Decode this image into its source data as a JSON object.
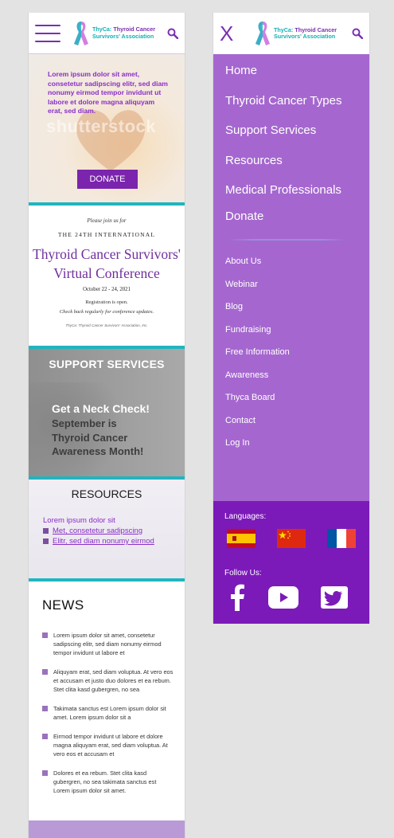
{
  "logo": {
    "line1_brand": "ThyCa:",
    "line1_rest": "Thyroid Cancer",
    "line2": "Survivors' Association"
  },
  "hero": {
    "text": "Lorem ipsum dolor sit amet, consetetur sadipscing elitr, sed diam nonumy eirmod tempor invidunt ut labore et dolore magna aliquyam erat, sed diam.",
    "watermark": "shutterstock",
    "donate_label": "DONATE"
  },
  "conference": {
    "join": "Please join us for",
    "intl": "THE 24TH INTERNATIONAL",
    "title_line1": "Thyroid Cancer Survivors'",
    "title_line2": "Virtual Conference",
    "dates": "October 22 - 24, 2021",
    "reg_open": "Registration is open.",
    "reg_check": "Check back regularly for conference updates.",
    "footer": "ThyCa: Thyroid Cancer Survivors' Association, Inc."
  },
  "support": {
    "heading": "SUPPORT SERVICES",
    "neck_check": "Get a Neck Check!",
    "awareness_line1": "September is",
    "awareness_line2": "Thyroid Cancer",
    "awareness_line3": "Awareness Month!"
  },
  "resources": {
    "heading": "RESOURCES",
    "lead": "Lorem ipsum dolor sit",
    "items": [
      "Met, consetetur sadipscing",
      "Elitr, sed diam nonumy eirmod"
    ]
  },
  "news": {
    "heading": "NEWS",
    "items": [
      "Lorem ipsum dolor sit amet, consetetur sadipscing elitr, sed diam nonumy eirmod tempor invidunt ut labore et",
      "Aliquyam erat, sed diam voluptua. At vero eos et accusam et justo duo dolores et ea rebum. Stet clita kasd gubergren, no sea",
      "Takimata sanctus est Lorem ipsum dolor sit amet. Lorem ipsum dolor sit a",
      "Eirmod tempor invidunt ut labore et dolore magna aliquyam erat, sed diam voluptua. At vero eos et accusam et",
      "Dolores et ea rebum. Stet clita kasd gubergren, no sea takimata sanctus est Lorem ipsum dolor sit amet."
    ]
  },
  "menu": {
    "close_label": "X",
    "main": [
      "Home",
      "Thyroid Cancer Types",
      "Support Services",
      "Resources",
      "Medical Professionals",
      "Donate"
    ],
    "sub": [
      "About Us",
      "Webinar",
      "Blog",
      "Fundraising",
      "Free Information",
      "Awareness",
      "Thyca Board",
      "Contact",
      "Log In"
    ],
    "languages_label": "Languages:",
    "follow_label": "Follow Us:"
  },
  "colors": {
    "purple": "#7b24ad",
    "menu_bg": "#a567cf",
    "menu_footer": "#7b1ab9",
    "teal": "#20b5bf"
  }
}
